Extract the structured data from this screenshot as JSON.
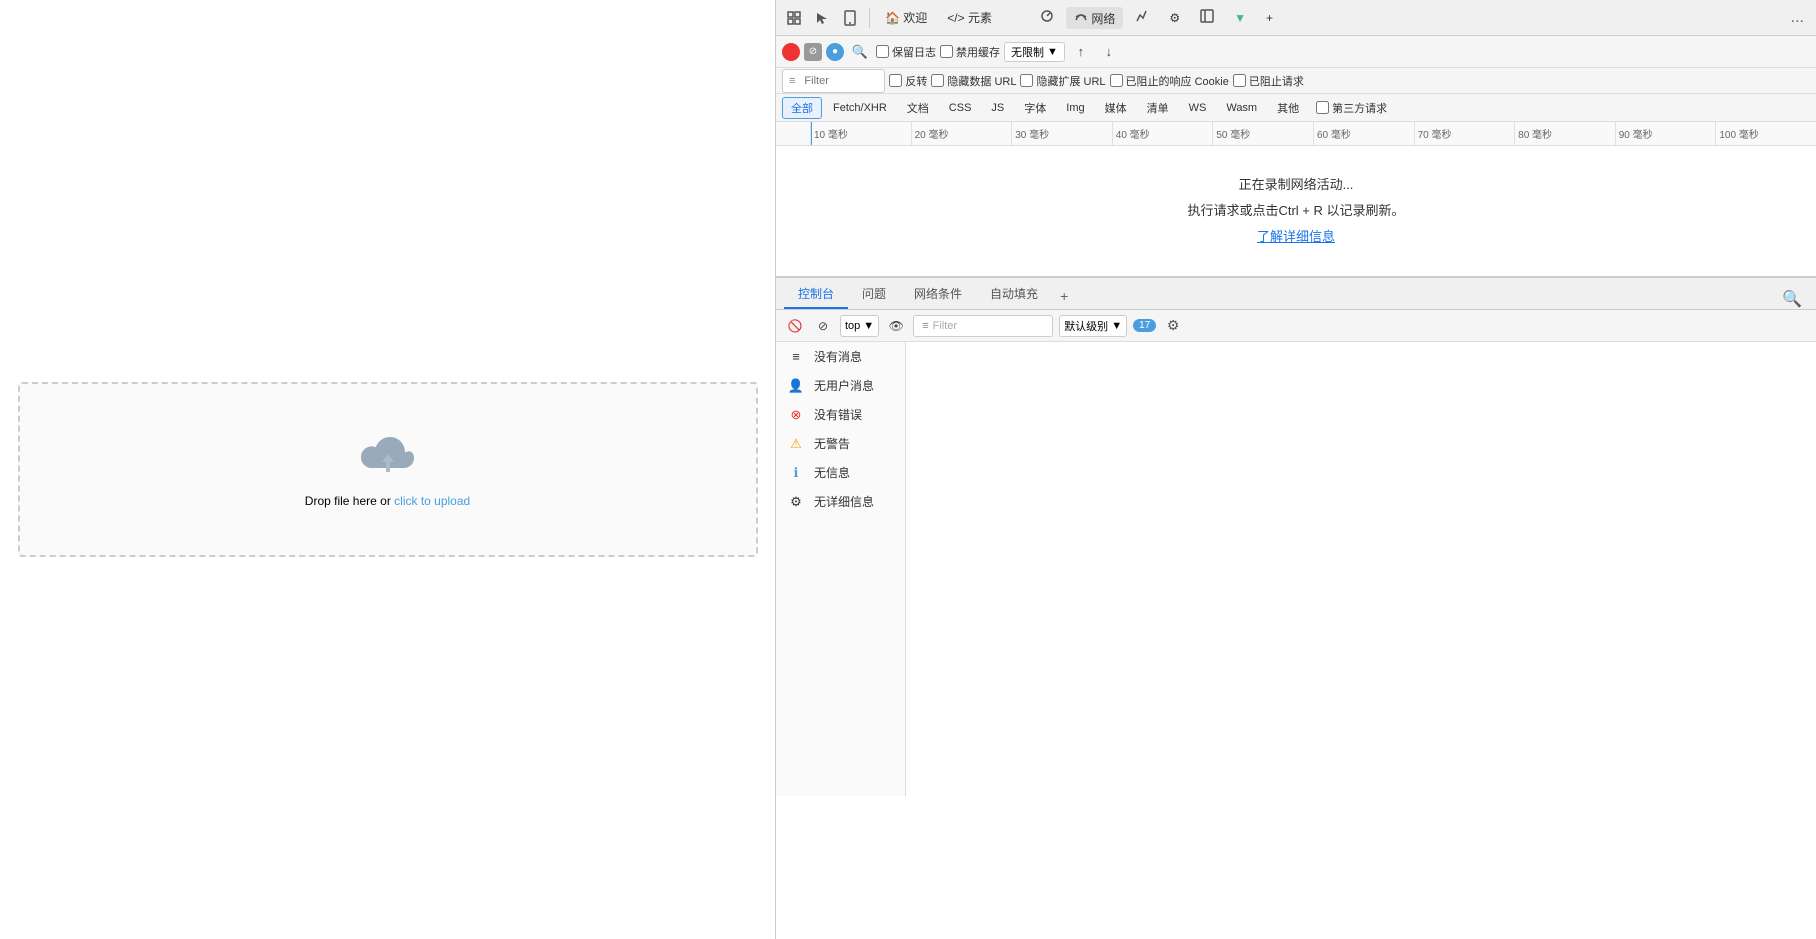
{
  "leftPanel": {
    "uploadText": "Drop file here or ",
    "uploadLink": "click to upload"
  },
  "devtools": {
    "topTabs": [
      {
        "label": "欢迎",
        "icon": "🏠"
      },
      {
        "label": "元素",
        "icon": "</>"
      },
      {
        "label": "网络",
        "active": true
      },
      {
        "label": "性能"
      },
      {
        "label": "设置",
        "icon": "⚙"
      },
      {
        "label": "VUE"
      }
    ],
    "moreLabel": "...",
    "networkBar": {
      "filterPlaceholder": "Filter",
      "reverse": "反转",
      "hideDataURL": "隐藏数据 URL",
      "hideExtURL": "隐藏扩展 URL",
      "unlimitedLabel": "无限制",
      "preserveLog": "保留日志",
      "disableCache": "禁用缓存"
    },
    "typeFilters": [
      "全部",
      "Fetch/XHR",
      "文档",
      "CSS",
      "JS",
      "字体",
      "Img",
      "媒体",
      "清单",
      "WS",
      "Wasm",
      "其他"
    ],
    "blockedResponse": "已阻止的响应 Cookie",
    "blockedRequest": "已阻止请求",
    "thirdParty": "第三方请求",
    "timeline": {
      "ticks": [
        "10 毫秒",
        "20 毫秒",
        "30 毫秒",
        "40 毫秒",
        "50 毫秒",
        "60 毫秒",
        "70 毫秒",
        "80 毫秒",
        "90 毫秒",
        "100 毫秒"
      ]
    },
    "emptyState": {
      "line1": "正在录制网络活动...",
      "line2": "执行请求或点击Ctrl + R 以记录刷新。",
      "link": "了解详细信息"
    },
    "bottomTabs": [
      "控制台",
      "问题",
      "网络条件",
      "自动填充"
    ],
    "addTabIcon": "+",
    "consoleBar": {
      "topLabel": "top",
      "filterPlaceholder": "Filter",
      "defaultSeverity": "默认级别",
      "errorCount": "17"
    },
    "consoleDropdown": {
      "items": [
        {
          "icon": "≡",
          "label": "没有消息"
        },
        {
          "icon": "👤",
          "label": "无用户消息"
        },
        {
          "icon": "⊗",
          "label": "没有错误",
          "iconColor": "#e33"
        },
        {
          "icon": "⚠",
          "label": "无警告",
          "iconColor": "#f90"
        },
        {
          "icon": "ℹ",
          "label": "无信息",
          "iconColor": "#4a9ede"
        },
        {
          "icon": "⚙",
          "label": "无详细信息"
        }
      ]
    }
  }
}
